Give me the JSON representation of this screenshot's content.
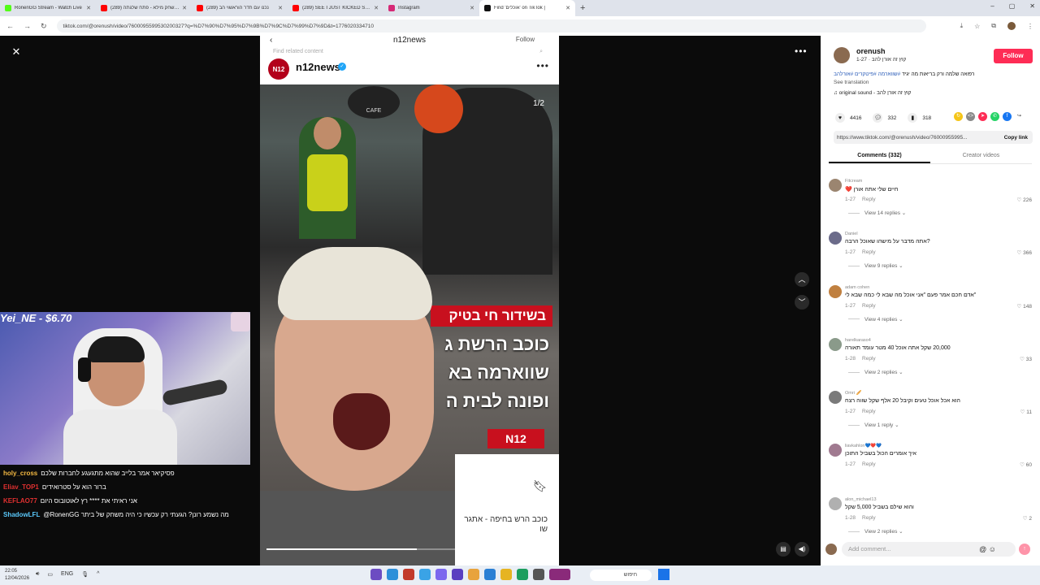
{
  "browser": {
    "tabs": [
      {
        "title": "RonenGG Stream - Watch Live",
        "color": "#53fc18",
        "active": false
      },
      {
        "title": "כהן שחק מילא - פתח שלגתה (289)",
        "color": "#ff0000",
        "active": false
      },
      {
        "title": "(289) נכנו עם חדר הוראשוי הב",
        "color": "#ff0000",
        "active": false
      },
      {
        "title": "(289) SEE I JUST KICKED STANI",
        "color": "#ff0000",
        "active": false
      },
      {
        "title": "Instagram",
        "color": "#d62976",
        "active": false
      },
      {
        "title": "Find 'אוכלים' on TikTok |",
        "color": "#111111",
        "active": true
      }
    ],
    "new_tab": "+",
    "url": "tiktok.com/@orenush/video/7600095599530200327?q=%D7%90%D7%95%D7%9B%D7%9C%D7%99%D7%9D&t=1776020334710",
    "window_controls": [
      "–",
      "▢",
      "✕"
    ]
  },
  "video": {
    "title": "n12news",
    "follow_hint": "Follow",
    "related": "Find related content",
    "channel_name": "n12news",
    "channel_logo": "N12",
    "counter": "1/2",
    "cafe_sign": "CAFE",
    "red_banner": "בשידור חי בטיק",
    "big_lines": [
      "כוכב הרשת ג",
      "שווארמה בא",
      "ופונה לבית ה"
    ],
    "n12_badge": "N12",
    "card_text": "כוכב הרש בחיפה - אתגר שו",
    "progress": 0.56
  },
  "stream": {
    "title": "Yei_NE - $6.70",
    "chat": [
      {
        "user": "holy_cross",
        "user_color": "#f4b942",
        "msg": "פסיקיאר אמר בלייב שהוא מתגעגע לחברות שלכם"
      },
      {
        "user": "Eliav_TOP1",
        "user_color": "#e03030",
        "msg": "ברור הוא על סטרואידים"
      },
      {
        "user": "KEFLAO77",
        "user_color": "#e03030",
        "msg": "אני ראיתי את **** רץ לאוטובוס היום"
      },
      {
        "user": "ShadowLFL",
        "user_color": "#5ac8fa",
        "msg": "@RonenGG מה נשמע רונן? הגעתי רק עכשיו כי היה משחק של ביתר"
      }
    ]
  },
  "side": {
    "author": "orenush",
    "author_meta": "קוץ זה אורן להב · 1-27",
    "follow": "Follow",
    "description": "רפואה שלמה ורק בריאות מה יגיד",
    "tags": "#שווארמה #פיטקרים #אורלהב",
    "see_translation": "See translation",
    "sound": "♫ original sound - קוץ זה אורן להב",
    "likes": "4416",
    "comments_count": "332",
    "saves": "318",
    "link": "https://www.tiktok.com/@orenush/video/76000955995...",
    "copy_link": "Copy link",
    "tab_comments": "Comments (332)",
    "tab_creator": "Creator videos",
    "add_comment": "Add comment...",
    "comments": [
      {
        "user": "Fitcream",
        "text": "חיים שלי אתה אורן ❤️",
        "date": "1-27",
        "reply": "Reply",
        "likes": "226",
        "replies": "View 14 replies ⌄"
      },
      {
        "user": "Daniel",
        "text": "?אתה מדבר על מישהו שאוכל הרבה",
        "date": "1-27",
        "reply": "Reply",
        "likes": "366",
        "replies": "View 9 replies ⌄"
      },
      {
        "user": "adam cohen",
        "text": "\"אדם חכם אמר פעם \"אני אוכל מה שבא לי כמה שבא לי",
        "date": "1-27",
        "reply": "Reply",
        "likes": "148",
        "replies": "View 4 replies ⌄"
      },
      {
        "user": "harelkaraso4",
        "text": "20,000 שקל אתה אוכל 40 מטר עומד תאורה",
        "date": "1-28",
        "reply": "Reply",
        "likes": "33",
        "replies": "View 2 replies ⌄"
      },
      {
        "user": "Omri 🥖",
        "text": "הוא אכל אוכל טעים וקיבל 20 אלף שקל שווה רצח",
        "date": "1-27",
        "reply": "Reply",
        "likes": "11",
        "replies": "View 1 reply ⌄"
      },
      {
        "user": "liavkahlon💙❤️💙",
        "text": "איך אומרים הכול בשביל התוכן",
        "date": "1-27",
        "reply": "Reply",
        "likes": "60",
        "replies": ""
      },
      {
        "user": "alon_michael13",
        "text": "והוא שילם בשביל 5,000 שקל",
        "date": "1-28",
        "reply": "Reply",
        "likes": "2",
        "replies": "View 2 replies ⌄"
      }
    ]
  },
  "taskbar": {
    "time": "22:05",
    "date": "12/04/2026",
    "lang": "ENG",
    "search": "חיפוש"
  }
}
